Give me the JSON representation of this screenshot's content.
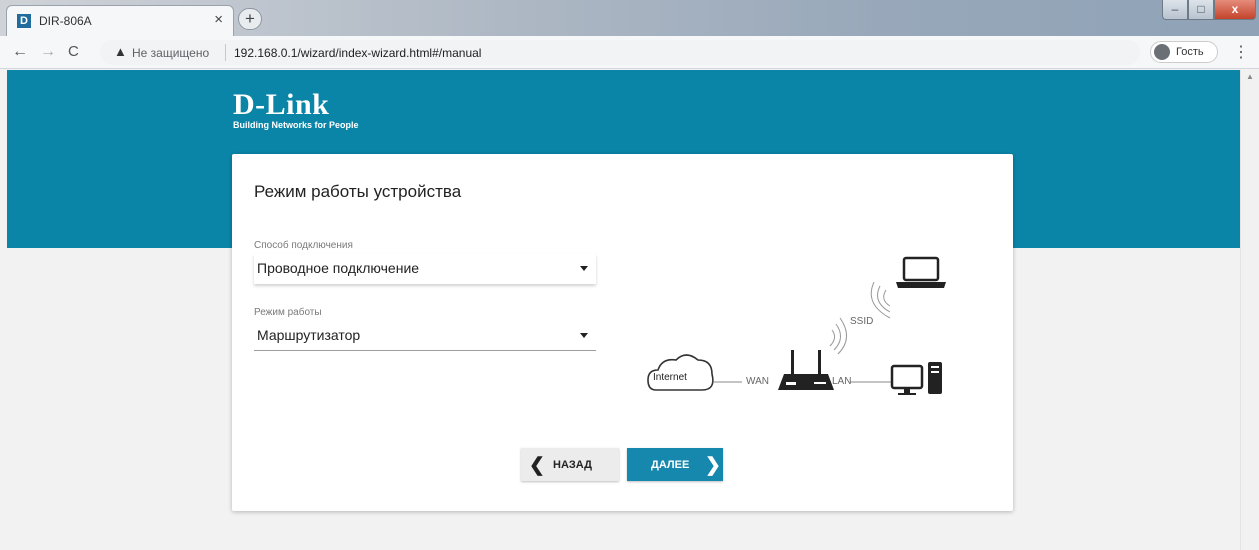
{
  "browser": {
    "tab_title": "DIR-806A",
    "tab_favicon": "D",
    "tab_close": "×",
    "new_tab": "+",
    "window_controls": {
      "minimize": "–",
      "maximize": "□",
      "close": "x"
    },
    "nav": {
      "back": "←",
      "forward": "→",
      "reload": "C"
    },
    "security_label": "Не защищено",
    "url": "192.168.0.1/wizard/index-wizard.html#/manual",
    "profile_label": "Гость",
    "menu": "⋮"
  },
  "brand": {
    "logo": "D-Link",
    "tagline": "Building Networks for People",
    "banner_color": "#0a85a8",
    "accent_color": "#1788ad"
  },
  "wizard": {
    "title": "Режим работы устройства",
    "connection": {
      "label": "Способ подключения",
      "value": "Проводное подключение"
    },
    "mode": {
      "label": "Режим работы",
      "value": "Маршрутизатор"
    },
    "diagram": {
      "internet": "Internet",
      "wan": "WAN",
      "lan": "LAN",
      "ssid": "SSID"
    },
    "back_label": "НАЗАД",
    "next_label": "ДАЛЕЕ"
  },
  "icons": [
    "warning-icon",
    "user-avatar-icon",
    "cloud-icon",
    "router-icon",
    "laptop-icon",
    "desktop-icon",
    "wifi-icon",
    "chevron-left-icon",
    "chevron-right-icon",
    "caret-down-icon"
  ]
}
